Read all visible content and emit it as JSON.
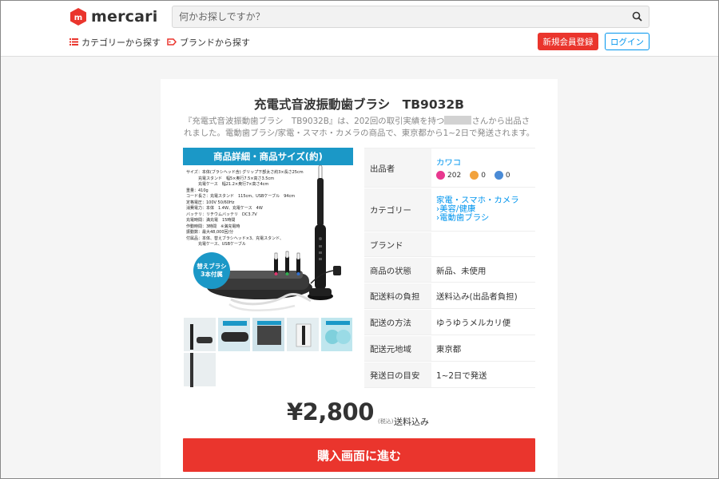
{
  "header": {
    "logo_text": "mercari",
    "search_placeholder": "何かお探しですか？",
    "nav_category": "カテゴリーから探す",
    "nav_brand": "ブランドから探す",
    "register_label": "新規会員登録",
    "login_label": "ログイン"
  },
  "item": {
    "title": "充電式音波振動歯ブラシ　TB9032B",
    "description_part1": "『充電式音波振動歯ブラシ　TB9032B』は、202回の取引実績を持つ",
    "description_part2": "さんから出品されました。電動歯ブラシ/家電・スマホ・カメラの商品で、東京都から1~2日で発送されます。",
    "image": {
      "header": "商品詳細・商品サイズ(約)",
      "specs": [
        "サイズ：本体(ブラシヘッド含) グリップ下部太さ約3×長さ25cm",
        "　　　充電スタンド　幅5×奥行7.5×高さ3.5cm",
        "　　　充電ケース　幅21.2×奥行7×高さ4cm",
        "重量：410g",
        "コード長さ：充電スタンド　115cm、USBケーブル　94cm",
        "定格電圧：100V 50/60Hz",
        "消費電力：本体　1.4W、充電ケース　4W",
        "バッテリ：リチウムバッテリ　DC3.7V",
        "充電時間：満充電　15時間",
        "作動時間：3時間　※満充電時",
        "振動数：最大48,000回/分",
        "付属品：本体、替えブラシヘッド×3、充電スタンド、",
        "　　　充電ケース、USBケーブル"
      ],
      "badge_line1": "替えブラシ",
      "badge_line2": "3本付属"
    },
    "details": {
      "seller_label": "出品者",
      "seller_name": "カワコ",
      "rating_good": "202",
      "rating_normal": "0",
      "rating_bad": "0",
      "category_label": "カテゴリー",
      "category_1": "家電・スマホ・カメラ",
      "category_2": "美容/健康",
      "category_3": "電動歯ブラシ",
      "brand_label": "ブランド",
      "condition_label": "商品の状態",
      "condition_value": "新品、未使用",
      "shipping_fee_label": "配送料の負担",
      "shipping_fee_value": "送料込み(出品者負担)",
      "shipping_method_label": "配送の方法",
      "shipping_method_value": "ゆうゆうメルカリ便",
      "ship_from_label": "配送元地域",
      "ship_from_value": "東京都",
      "ship_days_label": "発送日の目安",
      "ship_days_value": "1~2日で発送"
    },
    "price": "¥2,800",
    "tax_label": "(税込)",
    "shipping_included": "送料込み",
    "buy_label": "購入画面に進む"
  },
  "colors": {
    "brand_red": "#ea352d",
    "link_blue": "#0095ee",
    "image_header_blue": "#1b98c7"
  }
}
